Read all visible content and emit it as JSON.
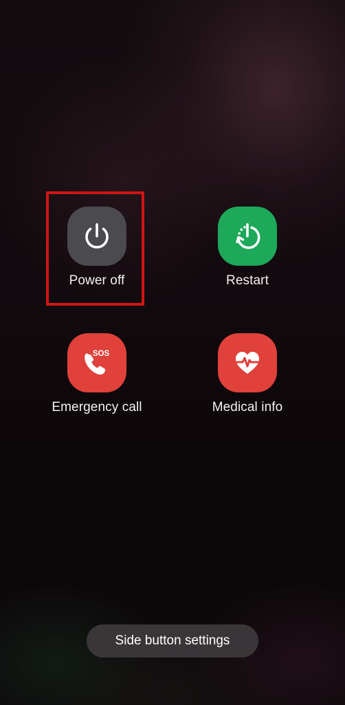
{
  "power_menu": {
    "items": [
      {
        "label": "Power off",
        "icon": "power-icon",
        "color": "#4a4a4f",
        "highlighted": true
      },
      {
        "label": "Restart",
        "icon": "restart-icon",
        "color": "#1ea85a"
      },
      {
        "label": "Emergency call",
        "icon": "sos-phone-icon",
        "color": "#e0413a",
        "badge": "SOS"
      },
      {
        "label": "Medical info",
        "icon": "medical-heart-icon",
        "color": "#e0413a"
      }
    ],
    "highlight_color": "#d01515"
  },
  "side_button": {
    "label": "Side button settings"
  }
}
